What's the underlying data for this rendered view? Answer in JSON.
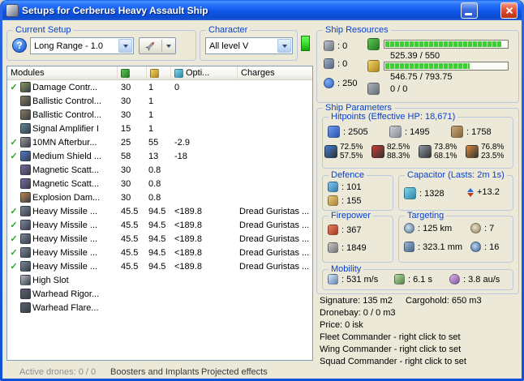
{
  "colors": {
    "label-blue": "#0a41c8",
    "check-green": "#2fa32f",
    "progress-green": "#3ad130",
    "skill-green": "#45e83a"
  },
  "window": {
    "title": "Setups for Cerberus Heavy Assault Ship"
  },
  "current_setup": {
    "label": "Current Setup",
    "help_glyph": "?",
    "selected": "Long Range - 1.0"
  },
  "character": {
    "label": "Character",
    "selected": "All level V"
  },
  "modules": {
    "check_glyph": "✓",
    "headers": {
      "name": "Modules",
      "opti": "Opti...",
      "charges": "Charges"
    },
    "rows": [
      {
        "active": true,
        "name": "Damage Contr...",
        "cpu": "30",
        "pg": "1",
        "opti": "0",
        "charges": "",
        "icon": "#8a9a5f"
      },
      {
        "active": false,
        "name": "Ballistic Control...",
        "cpu": "30",
        "pg": "1",
        "opti": "",
        "charges": "",
        "icon": "#8a7a5f"
      },
      {
        "active": false,
        "name": "Ballistic Control...",
        "cpu": "30",
        "pg": "1",
        "opti": "",
        "charges": "",
        "icon": "#8a7a5f"
      },
      {
        "active": false,
        "name": "Signal Amplifier I",
        "cpu": "15",
        "pg": "1",
        "opti": "",
        "charges": "",
        "icon": "#5f8a9a"
      },
      {
        "active": true,
        "name": "10MN Afterbur...",
        "cpu": "25",
        "pg": "55",
        "opti": "-2.9",
        "charges": "",
        "icon": "#9a9a9a"
      },
      {
        "active": true,
        "name": "Medium Shield ...",
        "cpu": "58",
        "pg": "13",
        "opti": "-18",
        "charges": "",
        "icon": "#4f7ad0"
      },
      {
        "active": false,
        "name": "Magnetic Scatt...",
        "cpu": "30",
        "pg": "0.8",
        "opti": "",
        "charges": "",
        "icon": "#7a6aa8"
      },
      {
        "active": false,
        "name": "Magnetic Scatt...",
        "cpu": "30",
        "pg": "0.8",
        "opti": "",
        "charges": "",
        "icon": "#7a6aa8"
      },
      {
        "active": false,
        "name": "Explosion Dam...",
        "cpu": "30",
        "pg": "0.8",
        "opti": "",
        "charges": "",
        "icon": "#c08a4a"
      },
      {
        "active": true,
        "name": "Heavy Missile ...",
        "cpu": "45.5",
        "pg": "94.5",
        "opti": "<189.8",
        "charges": "Dread Guristas ...",
        "icon": "#7a8699"
      },
      {
        "active": true,
        "name": "Heavy Missile ...",
        "cpu": "45.5",
        "pg": "94.5",
        "opti": "<189.8",
        "charges": "Dread Guristas ...",
        "icon": "#7a8699"
      },
      {
        "active": true,
        "name": "Heavy Missile ...",
        "cpu": "45.5",
        "pg": "94.5",
        "opti": "<189.8",
        "charges": "Dread Guristas ...",
        "icon": "#7a8699"
      },
      {
        "active": true,
        "name": "Heavy Missile ...",
        "cpu": "45.5",
        "pg": "94.5",
        "opti": "<189.8",
        "charges": "Dread Guristas ...",
        "icon": "#7a8699"
      },
      {
        "active": true,
        "name": "Heavy Missile ...",
        "cpu": "45.5",
        "pg": "94.5",
        "opti": "<189.8",
        "charges": "Dread Guristas ...",
        "icon": "#7a8699"
      },
      {
        "active": false,
        "name": "High Slot",
        "cpu": "",
        "pg": "",
        "opti": "",
        "charges": "",
        "icon": "#b8bcc4"
      },
      {
        "active": false,
        "name": "Warhead Rigor...",
        "cpu": "",
        "pg": "",
        "opti": "",
        "charges": "",
        "icon": "#5a6070"
      },
      {
        "active": false,
        "name": "Warhead Flare...",
        "cpu": "",
        "pg": "",
        "opti": "",
        "charges": "",
        "icon": "#5a6070"
      }
    ]
  },
  "bottom_sections": [
    {
      "label": "Active drones: 0 / 0",
      "muted": true
    },
    {
      "label": "Boosters and Implants",
      "muted": false
    },
    {
      "label": "Projected effects",
      "muted": false
    }
  ],
  "ship_resources": {
    "label": "Ship Resources",
    "turrets": ": 0",
    "launchers": ": 0",
    "calibration": ": 250",
    "cpu_text": "525.39 / 550",
    "cpu_pct": 95.5,
    "powergrid_text": "546.75 / 793.75",
    "powergrid_pct": 69,
    "dronebay_text": "0 / 0"
  },
  "ship_parameters": {
    "label": "Ship Parameters",
    "hitpoints": {
      "label": "Hitpoints (Effective HP: 18,671)",
      "shield": ": 2505",
      "armor": ": 1495",
      "structure": ": 1758",
      "resists": [
        {
          "type": "em",
          "color": "#3f7fd9",
          "shield": "72.5%",
          "armor": "57.5%"
        },
        {
          "type": "thermal",
          "color": "#d03b2f",
          "shield": "82.5%",
          "armor": "88.3%"
        },
        {
          "type": "kinetic",
          "color": "#8d9aa8",
          "shield": "73.8%",
          "armor": "68.1%"
        },
        {
          "type": "explosive",
          "color": "#d98a3f",
          "shield": "76.8%",
          "armor": "23.5%"
        }
      ]
    },
    "defence": {
      "label": "Defence",
      "value1": ": 101",
      "value2": ": 155"
    },
    "capacitor": {
      "label": "Capacitor (Lasts: 2m 1s)",
      "amount": ": 1328",
      "recharge": "+13.2"
    },
    "firepower": {
      "label": "Firepower",
      "value1": ": 367",
      "value2": ": 1849"
    },
    "targeting": {
      "label": "Targeting",
      "range": ": 125 km",
      "max_targets": ": 7",
      "scan_resolution": ": 323.1 mm",
      "sensor_strength": ": 16"
    },
    "mobility": {
      "label": "Mobility",
      "speed": ": 531 m/s",
      "align_time": ": 6.1 s",
      "warp_speed": ": 3.8 au/s"
    }
  },
  "info": {
    "signature": "Signature: 135 m2",
    "cargohold": "Cargohold: 650 m3",
    "dronebay": "Dronebay: 0 / 0 m3",
    "price": "Price: 0 isk",
    "fleet_commander": "Fleet Commander - right click to set",
    "wing_commander": "Wing Commander - right click to set",
    "squad_commander": "Squad Commander - right click to set"
  }
}
